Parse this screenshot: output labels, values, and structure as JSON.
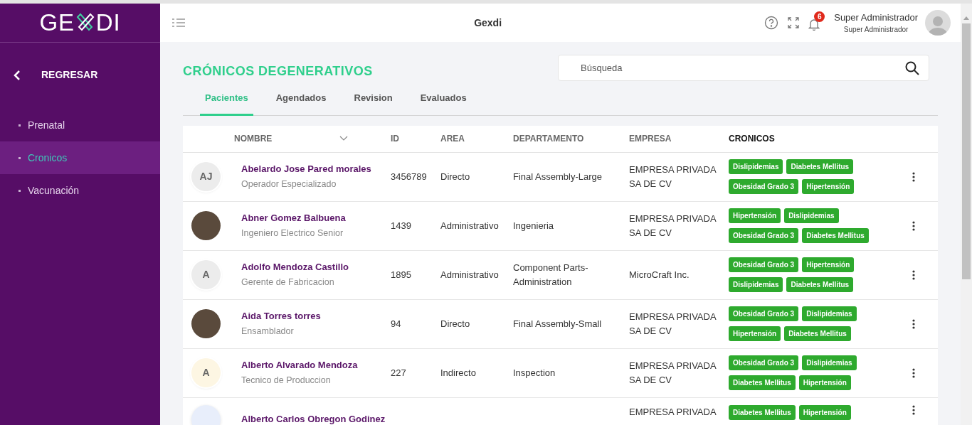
{
  "sidebar": {
    "logo": "GE",
    "logo_end": "DI",
    "back": "REGRESAR",
    "items": [
      {
        "label": "Prenatal",
        "selected": false
      },
      {
        "label": "Cronicos",
        "selected": true
      },
      {
        "label": "Vacunación",
        "selected": false
      }
    ]
  },
  "header": {
    "title": "Gexdi",
    "notifications": "6",
    "user_name": "Super Administrador",
    "user_role": "Super Administrador"
  },
  "page": {
    "title": "CRÓNICOS DEGENERATIVOS",
    "search": {
      "placeholder": "Búsqueda"
    },
    "tabs": [
      {
        "label": "Pacientes",
        "selected": true
      },
      {
        "label": "Agendados",
        "selected": false
      },
      {
        "label": "Revision",
        "selected": false
      },
      {
        "label": "Evaluados",
        "selected": false
      }
    ]
  },
  "table": {
    "columns": [
      "NOMBRE",
      "ID",
      "AREA",
      "DEPARTAMENTO",
      "EMPRESA",
      "CRONICOS"
    ],
    "rows": [
      {
        "avatar": {
          "kind": "initials",
          "text": "AJ",
          "color": "#ececec"
        },
        "name": "Abelardo Jose Pared morales",
        "role": "Operador Especializado",
        "id": "3456789",
        "area": "Directo",
        "department": "Final Assembly-Large",
        "company": "EMPRESA PRIVADA SA DE CV",
        "tags": [
          "Dislipidemias",
          "Diabetes Mellitus",
          "Obesidad Grado 3",
          "Hipertensión"
        ]
      },
      {
        "avatar": {
          "kind": "photo"
        },
        "name": "Abner Gomez Balbuena",
        "role": "Ingeniero Electrico Senior",
        "id": "1439",
        "area": "Administrativo",
        "department": "Ingenieria",
        "company": "EMPRESA PRIVADA SA DE CV",
        "tags": [
          "Hipertensión",
          "Dislipidemias",
          "Obesidad Grado 3",
          "Diabetes Mellitus"
        ]
      },
      {
        "avatar": {
          "kind": "initials",
          "text": "A",
          "color": "#ececec"
        },
        "name": "Adolfo Mendoza Castillo",
        "role": "Gerente de Fabricacion",
        "id": "1895",
        "area": "Administrativo",
        "department": "Component Parts-Administration",
        "company": "MicroCraft Inc.",
        "tags": [
          "Obesidad Grado 3",
          "Hipertensión",
          "Dislipidemias",
          "Diabetes Mellitus"
        ]
      },
      {
        "avatar": {
          "kind": "photo"
        },
        "name": "Aida Torres torres",
        "role": "Ensamblador",
        "id": "94",
        "area": "Directo",
        "department": "Final Assembly-Small",
        "company": "EMPRESA PRIVADA SA DE CV",
        "tags": [
          "Obesidad Grado 3",
          "Dislipidemias",
          "Hipertensión",
          "Diabetes Mellitus"
        ]
      },
      {
        "avatar": {
          "kind": "initials",
          "text": "A",
          "color": "#fdf6e3"
        },
        "name": "Alberto Alvarado Mendoza",
        "role": "Tecnico de Produccion",
        "id": "227",
        "area": "Indirecto",
        "department": "Inspection",
        "company": "EMPRESA PRIVADA SA DE CV",
        "tags": [
          "Obesidad Grado 3",
          "Dislipidemias",
          "Diabetes Mellitus",
          "Hipertensión"
        ]
      },
      {
        "avatar": {
          "kind": "blank",
          "color": "#e8eefb"
        },
        "name": "Alberto Carlos Obregon Godinez",
        "company": "EMPRESA PRIVADA",
        "tags": [
          "Diabetes Mellitus",
          "Hipertensión"
        ]
      }
    ]
  }
}
